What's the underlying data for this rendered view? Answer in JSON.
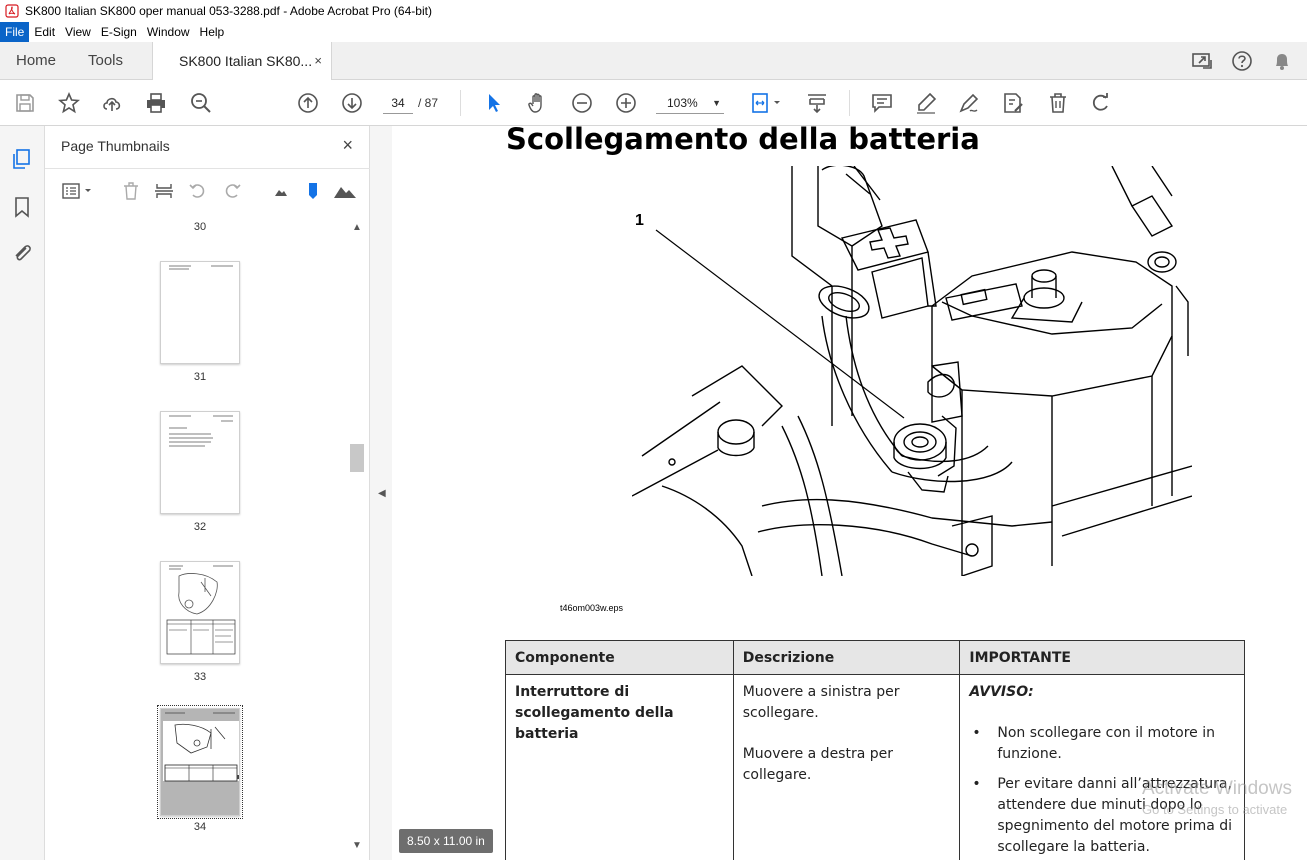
{
  "window": {
    "title": "SK800 Italian SK800 oper manual 053-3288.pdf - Adobe Acrobat Pro (64-bit)"
  },
  "menu": [
    "File",
    "Edit",
    "View",
    "E-Sign",
    "Window",
    "Help"
  ],
  "tabs": {
    "home": "Home",
    "tools": "Tools",
    "document": "SK800 Italian SK80...",
    "close_glyph": "×"
  },
  "toolbar": {
    "page_current": "34",
    "page_total": "/ 87",
    "zoom": "103%",
    "zoom_caret": "▼"
  },
  "thumbnails_panel": {
    "title": "Page Thumbnails",
    "close_glyph": "×",
    "pages": [
      "30",
      "31",
      "32",
      "33",
      "34"
    ],
    "selected_page": "34"
  },
  "document": {
    "heading": "Scollegamento della batteria",
    "callout": "1",
    "image_filename": "t46om003w.eps",
    "table": {
      "headers": [
        "Componente",
        "Descrizione",
        "IMPORTANTE"
      ],
      "component": "Interruttore di scollegamento della batteria",
      "desc_left": "Muovere a sinistra per scollegare.",
      "desc_right": "Muovere a destra per collegare.",
      "avviso": "AVVISO:",
      "bullets": [
        "Non scollegare con il motore in funzione.",
        "Per evitare danni all’attrezzatura, attendere due minuti dopo lo spegnimento del motore prima di scollegare la batteria."
      ]
    }
  },
  "status": {
    "page_size": "8.50 x 11.00 in"
  },
  "watermark": {
    "line1": "Activate Windows",
    "line2": "Go to Settings to activate"
  },
  "colors": {
    "menu_active": "#0a64c8",
    "toolbar_icon": "#555555",
    "selected_tool": "#1473e6"
  }
}
